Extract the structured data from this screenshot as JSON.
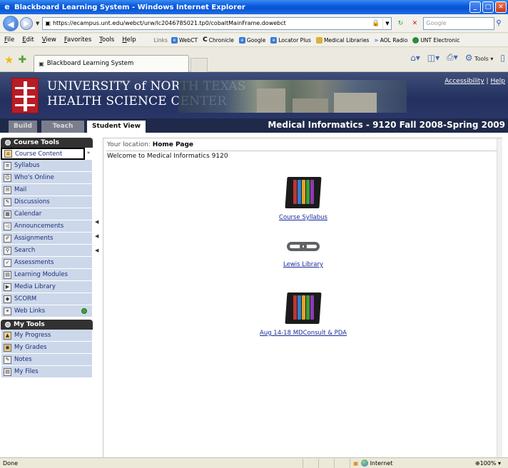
{
  "window": {
    "title": "Blackboard Learning System - Windows Internet Explorer",
    "address": "https://ecampus.unt.edu/webct/urw/lc2046785021.tp0/cobaltMainFrame.dowebct",
    "search_placeholder": "Google",
    "menu": [
      "File",
      "Edit",
      "View",
      "Favorites",
      "Tools",
      "Help"
    ],
    "links_label": "Links",
    "links": [
      "WebCT",
      "Chronicle",
      "Google",
      "Locator Plus",
      "Medical Libraries",
      "AOL Radio",
      "UNT Electronic"
    ],
    "tab_title": "Blackboard Learning System",
    "tools_label": "Tools",
    "status": "Done",
    "zone": "Internet",
    "zoom": "100%"
  },
  "header": {
    "university_line1": "UNIVERSITY of NORTH TEXAS",
    "university_line2": "HEALTH SCIENCE CENTER",
    "accessibility": "Accessibility",
    "separator": "|",
    "help": "Help",
    "course_title": "Medical Informatics - 9120 Fall 2008-Spring 2009"
  },
  "view_tabs": [
    "Build",
    "Teach",
    "Student View"
  ],
  "course_tools": {
    "title": "Course Tools",
    "items": [
      "Course Content",
      "Syllabus",
      "Who's Online",
      "Mail",
      "Discussions",
      "Calendar",
      "Announcements",
      "Assignments",
      "Search",
      "Assessments",
      "Learning Modules",
      "Media Library",
      "SCORM",
      "Web Links"
    ]
  },
  "my_tools": {
    "title": "My Tools",
    "items": [
      "My Progress",
      "My Grades",
      "Notes",
      "My Files"
    ]
  },
  "content": {
    "location_label": "Your location:",
    "location": "Home Page",
    "welcome": "Welcome to Medical Informatics 9120",
    "items": [
      "Course Syllabus",
      "Lewis Library",
      "Aug 14-18 MDConsult & PDA"
    ]
  }
}
